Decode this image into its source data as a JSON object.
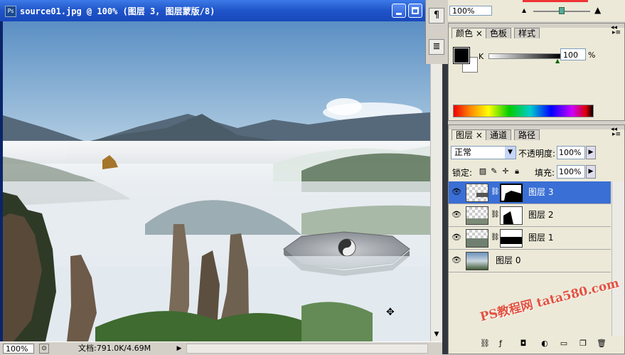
{
  "document": {
    "title": "source01.jpg @ 100% (图层 3, 图层蒙版/8)",
    "zoom": "100%",
    "doc_info": "文档:791.0K/4.69M"
  },
  "toolbox": {
    "icons": [
      "paragraph-icon",
      "notes-icon"
    ]
  },
  "navigator": {
    "zoom": "100%",
    "zoom_level": 0.5
  },
  "color_panel": {
    "tabs": [
      "颜色",
      "色板",
      "样式"
    ],
    "channel_label": "K",
    "value": "100",
    "unit": "%",
    "foreground": "#000000",
    "background": "#ffffff"
  },
  "layers_panel": {
    "tabs": [
      "图层",
      "通道",
      "路径"
    ],
    "blend_mode": "正常",
    "opacity_label": "不透明度:",
    "opacity": "100%",
    "lock_label": "锁定:",
    "fill_label": "填充:",
    "fill": "100%",
    "layers": [
      {
        "name": "图层 3",
        "selected": true,
        "has_mask": true
      },
      {
        "name": "图层 2",
        "selected": false,
        "has_mask": true
      },
      {
        "name": "图层 1",
        "selected": false,
        "has_mask": true
      },
      {
        "name": "图层 0",
        "selected": false,
        "has_mask": false
      }
    ]
  },
  "watermark": "PS教程网 tata580.com",
  "colors": {
    "selection": "#3a6fd5",
    "titlebar": "#1f54c8",
    "watermark": "#e23c2c"
  }
}
